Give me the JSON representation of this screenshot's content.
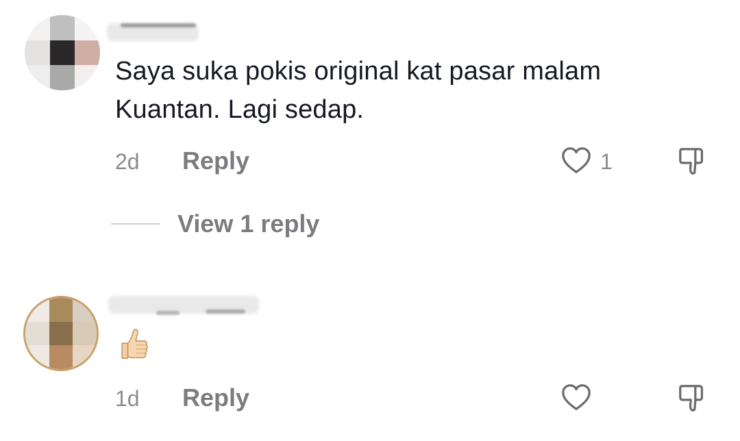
{
  "comments": [
    {
      "username": "",
      "text_line1": "Saya suka pokis original kat pasar malam",
      "text_line2": "Kuantan. Lagi sedap.",
      "age": "2d",
      "reply_label": "Reply",
      "like_count": "1",
      "view_replies_label": "View 1 reply",
      "avatar_icon": "pixelated-avatar"
    },
    {
      "username": "",
      "emoji": "thumbs-up-emoji",
      "age": "1d",
      "reply_label": "Reply",
      "like_count": "",
      "avatar_icon": "pixelated-avatar"
    }
  ],
  "colors": {
    "text": "#161823",
    "secondary": "#7c7c80",
    "divider": "#d0d0d3",
    "background": "#ffffff"
  },
  "icons": [
    "heart-outline-icon",
    "thumbs-down-outline-icon",
    "thumbs-up-emoji"
  ]
}
